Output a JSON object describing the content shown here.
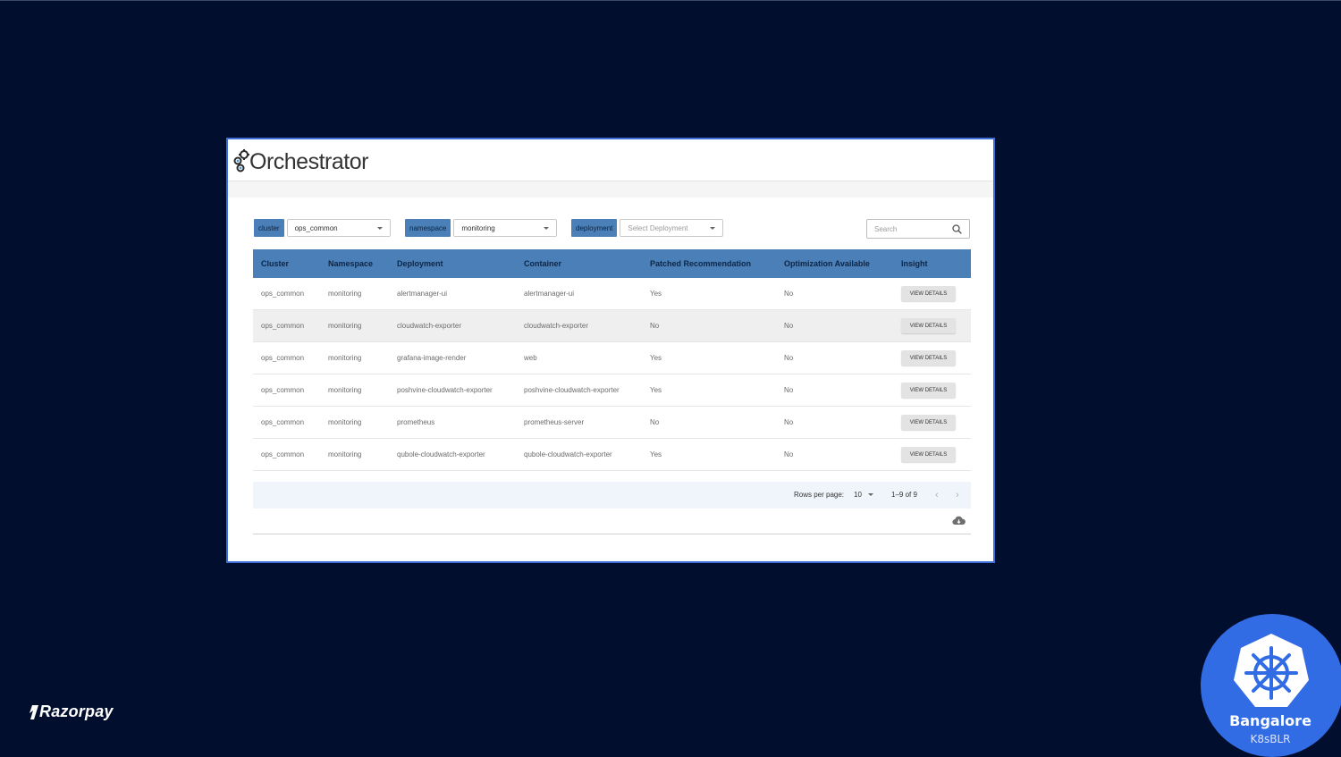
{
  "app": {
    "logo_text": "Orchestrator",
    "filters": [
      {
        "tag": "cluster",
        "value": "ops_common",
        "placeholder": ""
      },
      {
        "tag": "namespace",
        "value": "monitoring",
        "placeholder": ""
      },
      {
        "tag": "deployment",
        "value": "",
        "placeholder": "Select Deployment"
      }
    ],
    "search": {
      "placeholder": "Search",
      "icon": "search-icon"
    },
    "table": {
      "columns": [
        "Cluster",
        "Namespace",
        "Deployment",
        "Container",
        "Patched Recommendation",
        "Optimization Available",
        "Insight"
      ],
      "rows": [
        {
          "cluster": "ops_common",
          "namespace": "monitoring",
          "deployment": "alertmanager-ui",
          "container": "alertmanager-ui",
          "patched": "Yes",
          "optimization": "No",
          "insight": "VIEW DETAILS"
        },
        {
          "cluster": "ops_common",
          "namespace": "monitoring",
          "deployment": "cloudwatch-exporter",
          "container": "cloudwatch-exporter",
          "patched": "No",
          "optimization": "No",
          "insight": "VIEW DETAILS"
        },
        {
          "cluster": "ops_common",
          "namespace": "monitoring",
          "deployment": "grafana-image-render",
          "container": "web",
          "patched": "Yes",
          "optimization": "No",
          "insight": "VIEW DETAILS"
        },
        {
          "cluster": "ops_common",
          "namespace": "monitoring",
          "deployment": "poshvine-cloudwatch-exporter",
          "container": "poshvine-cloudwatch-exporter",
          "patched": "Yes",
          "optimization": "No",
          "insight": "VIEW DETAILS"
        },
        {
          "cluster": "ops_common",
          "namespace": "monitoring",
          "deployment": "prometheus",
          "container": "prometheus-server",
          "patched": "No",
          "optimization": "No",
          "insight": "VIEW DETAILS"
        },
        {
          "cluster": "ops_common",
          "namespace": "monitoring",
          "deployment": "qubole-cloudwatch-exporter",
          "container": "qubole-cloudwatch-exporter",
          "patched": "Yes",
          "optimization": "No",
          "insight": "VIEW DETAILS"
        }
      ]
    },
    "pagination": {
      "rows_per_page_label": "Rows per page:",
      "rows_per_page_value": "10",
      "range": "1–9 of 9",
      "prev_icon": "chevron-left-icon",
      "next_icon": "chevron-right-icon"
    },
    "download_icon": "cloud-download-icon"
  },
  "brand": {
    "razorpay": "Razorpay",
    "badge_title": "Bangalore",
    "badge_subtitle": "K8sBLR"
  },
  "colors": {
    "background": "#020e2d",
    "frame_border": "#3d6fd9",
    "table_header": "#4a7fb8",
    "badge": "#326ce5"
  }
}
